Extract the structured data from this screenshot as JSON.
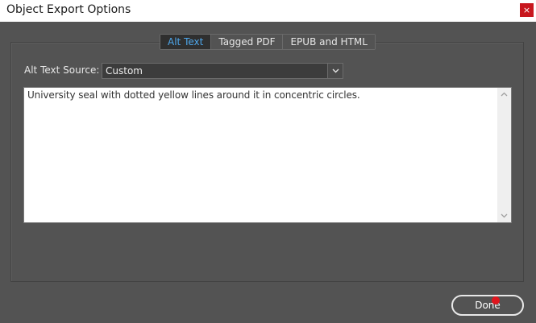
{
  "window": {
    "title": "Object Export Options",
    "close_glyph": "×"
  },
  "tabs": [
    {
      "label": "Alt Text",
      "active": true
    },
    {
      "label": "Tagged PDF",
      "active": false
    },
    {
      "label": "EPUB and HTML",
      "active": false
    }
  ],
  "alt_text": {
    "source_label": "Alt Text Source:",
    "source_value": "Custom",
    "text_value": "University seal with dotted yellow lines around it in concentric circles."
  },
  "footer": {
    "done_label": "Done"
  },
  "colors": {
    "background": "#535353",
    "active_tab_text": "#4ea6ea",
    "close_button": "#c8171e",
    "cursor_marker": "#e0161e"
  },
  "icons": {
    "dropdown": "chevron-down-icon",
    "scroll_up": "chevron-up-icon",
    "scroll_down": "chevron-down-icon"
  }
}
